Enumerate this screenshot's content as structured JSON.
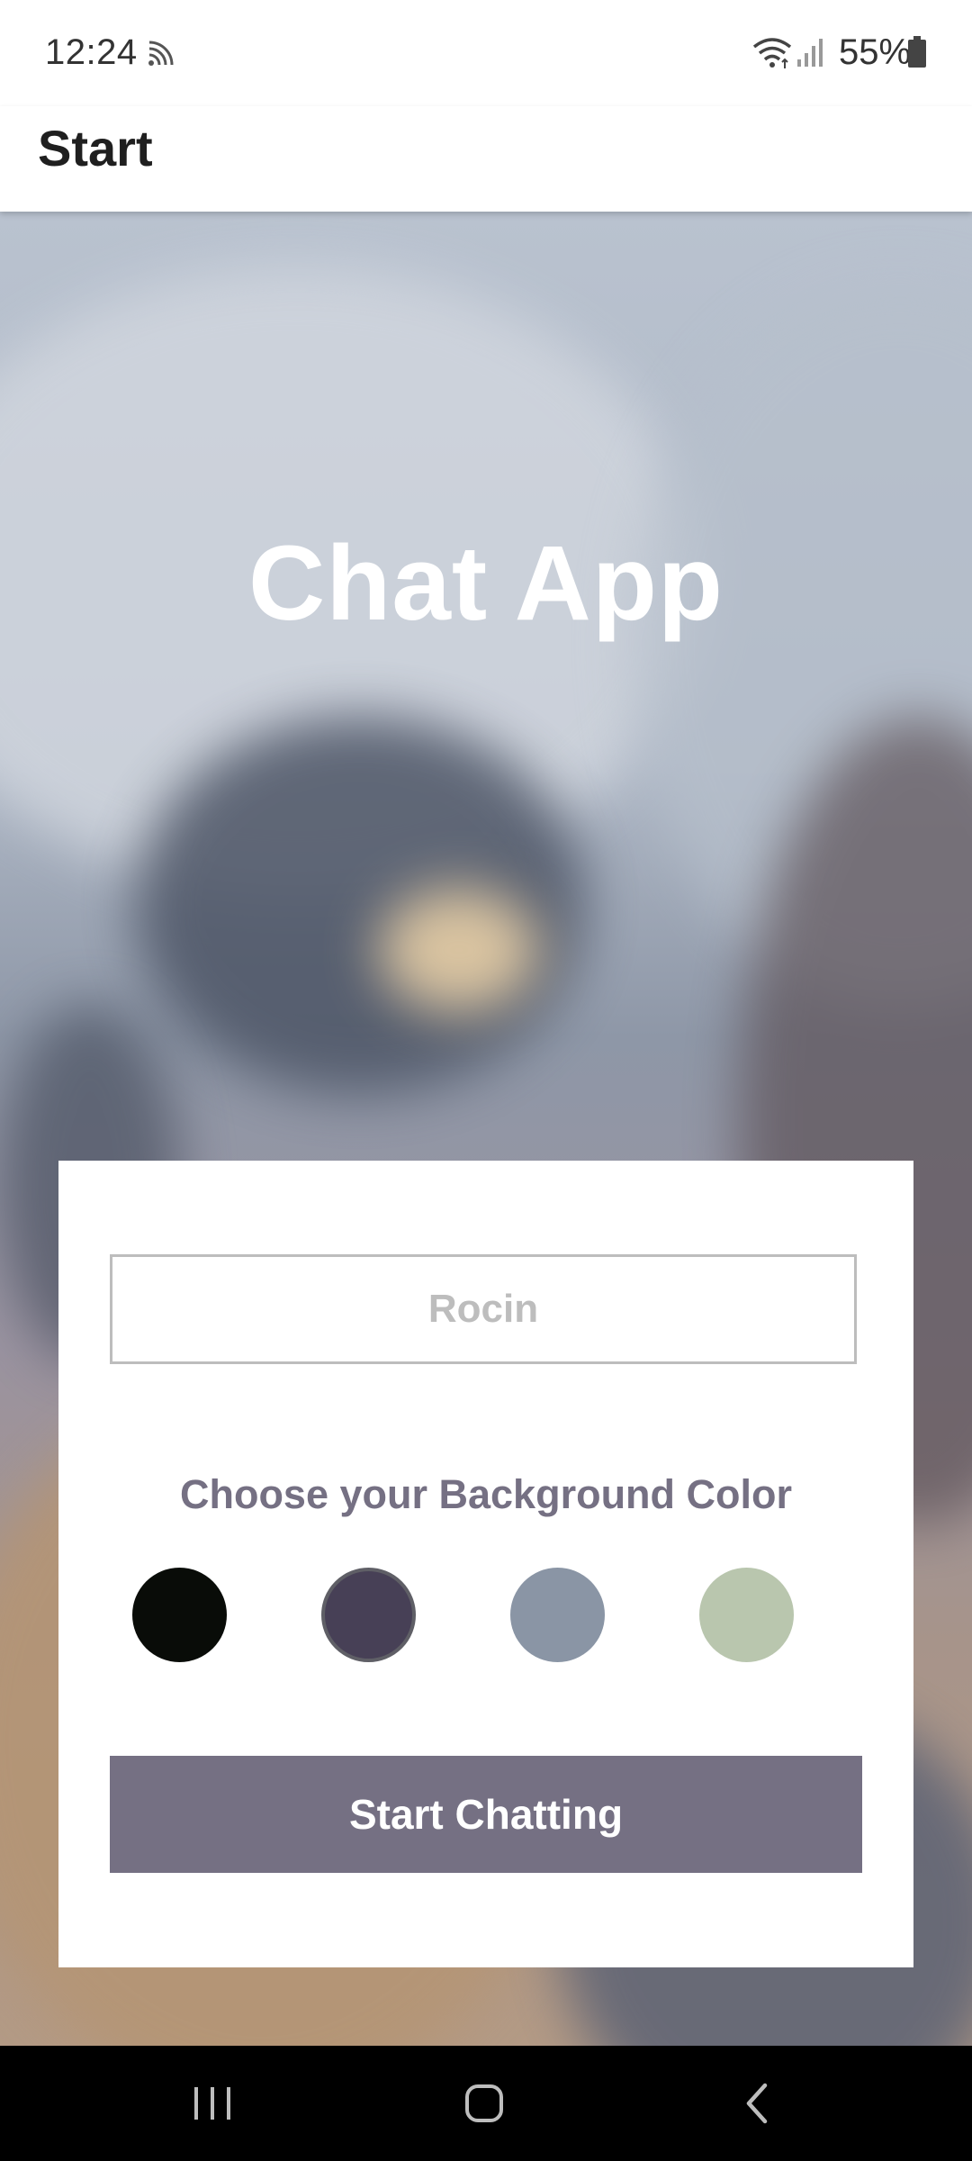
{
  "status_bar": {
    "time": "12:24",
    "battery_text": "55%",
    "icons": [
      "cast-icon",
      "wifi-icon",
      "signal-icon",
      "battery-icon"
    ]
  },
  "app_bar": {
    "title": "Start"
  },
  "main": {
    "app_title": "Chat App",
    "name_input": {
      "value": "",
      "placeholder": "Rocin"
    },
    "choose_label": "Choose your Background Color",
    "colors": [
      {
        "name": "color-black",
        "hex": "#090C08",
        "selected": false
      },
      {
        "name": "color-purple",
        "hex": "#474056",
        "selected": true
      },
      {
        "name": "color-grey-blue",
        "hex": "#8A95A5",
        "selected": false
      },
      {
        "name": "color-green",
        "hex": "#B9C6AE",
        "selected": false
      }
    ],
    "start_button": {
      "label": "Start Chatting",
      "color": "#757083"
    }
  },
  "nav_bar": {
    "buttons": [
      "recent-apps-icon",
      "home-icon",
      "back-icon"
    ]
  }
}
